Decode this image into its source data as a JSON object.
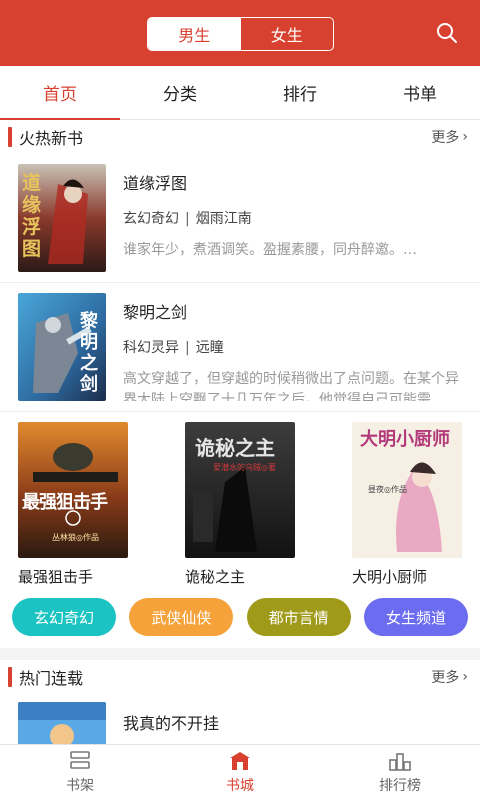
{
  "header": {
    "gender_male": "男生",
    "gender_female": "女生",
    "active_gender": "男生",
    "search_icon": "search-icon",
    "brand_color": "#d8412f"
  },
  "tabs": [
    {
      "label": "首页",
      "active": true
    },
    {
      "label": "分类",
      "active": false
    },
    {
      "label": "排行",
      "active": false
    },
    {
      "label": "书单",
      "active": false
    }
  ],
  "hot_new": {
    "title": "火热新书",
    "more": "更多",
    "list": [
      {
        "title": "道缘浮图",
        "genre": "玄幻奇幻",
        "sep": "|",
        "author": "烟雨江南",
        "desc": "谁家年少，煮酒调笑。盈握素腰，同舟醉邀。…",
        "cover_text": "道缘浮图"
      },
      {
        "title": "黎明之剑",
        "genre": "科幻灵异",
        "sep": "|",
        "author": "远瞳",
        "desc": "高文穿越了，但穿越的时候稍微出了点问题。在某个异界大陆上空飘了十几万年之后，他觉得自己可能需…",
        "cover_text": "黎明之剑"
      }
    ],
    "grid": [
      {
        "title": "最强狙击手",
        "cover_text": "最强狙击手",
        "cover_sub": "丛林狼◎作品"
      },
      {
        "title": "诡秘之主",
        "cover_text": "诡秘之主",
        "cover_sub": "爱潜水的乌贼◎著"
      },
      {
        "title": "大明小厨师",
        "cover_text": "大明小厨师",
        "cover_sub": "昼夜◎作品"
      }
    ]
  },
  "chips": [
    {
      "label": "玄幻奇幻",
      "color": "#1cc3c3"
    },
    {
      "label": "武侠仙侠",
      "color": "#f5a23a"
    },
    {
      "label": "都市言情",
      "color": "#a09a1a"
    },
    {
      "label": "女生频道",
      "color": "#6b6cf0"
    }
  ],
  "hot_serial": {
    "title": "热门连载",
    "more": "更多",
    "list": [
      {
        "title": "我真的不开挂"
      }
    ]
  },
  "bottom_nav": [
    {
      "label": "书架",
      "icon": "bookshelf-icon",
      "active": false
    },
    {
      "label": "书城",
      "icon": "bookstore-icon",
      "active": true
    },
    {
      "label": "排行榜",
      "icon": "ranking-icon",
      "active": false
    }
  ]
}
